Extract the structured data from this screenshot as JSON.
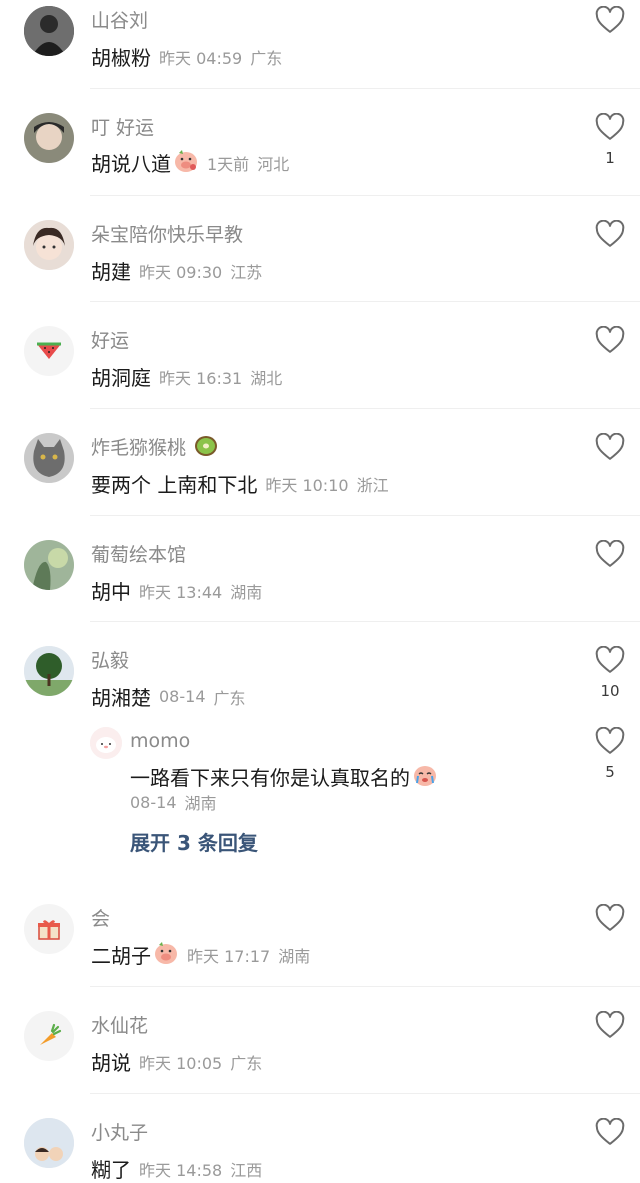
{
  "comments": [
    {
      "user": "山谷刘",
      "text": "胡椒粉",
      "time": "昨天 04:59",
      "region": "广东",
      "likes": ""
    },
    {
      "user": "叮 好运",
      "text": "胡说八道",
      "time": "1天前",
      "region": "河北",
      "likes": "1"
    },
    {
      "user": "朵宝陪你快乐早教",
      "text": "胡建",
      "time": "昨天 09:30",
      "region": "江苏",
      "likes": ""
    },
    {
      "user": "好运",
      "text": "胡洞庭",
      "time": "昨天 16:31",
      "region": "湖北",
      "likes": ""
    },
    {
      "user": "炸毛猕猴桃",
      "text": "要两个 上南和下北",
      "time": "昨天 10:10",
      "region": "浙江",
      "likes": ""
    },
    {
      "user": "葡萄绘本馆",
      "text": "胡中",
      "time": "昨天 13:44",
      "region": "湖南",
      "likes": ""
    },
    {
      "user": "弘毅",
      "text": "胡湘楚",
      "time": "08-14",
      "region": "广东",
      "likes": "10"
    },
    {
      "user": "会",
      "text": "二胡子",
      "time": "昨天 17:17",
      "region": "湖南",
      "likes": ""
    },
    {
      "user": "水仙花",
      "text": "胡说",
      "time": "昨天 10:05",
      "region": "广东",
      "likes": ""
    },
    {
      "user": "小丸子",
      "text": "糊了",
      "time": "昨天 14:58",
      "region": "江西",
      "likes": ""
    }
  ],
  "reply": {
    "user": "momo",
    "text": "一路看下来只有你是认真取名的",
    "time": "08-14",
    "region": "湖南",
    "likes": "5"
  },
  "expand_label": "展开 3 条回复",
  "icons": {
    "like": "heart-outline-icon",
    "emoji_pig": "pig-face-emoji",
    "emoji_kiwi": "kiwi-emoji",
    "emoji_cry": "crying-face-emoji"
  },
  "colors": {
    "username": "#8a8a8a",
    "meta": "#9a9a9a",
    "text": "#1b1b1b",
    "expand": "#3a5578"
  }
}
